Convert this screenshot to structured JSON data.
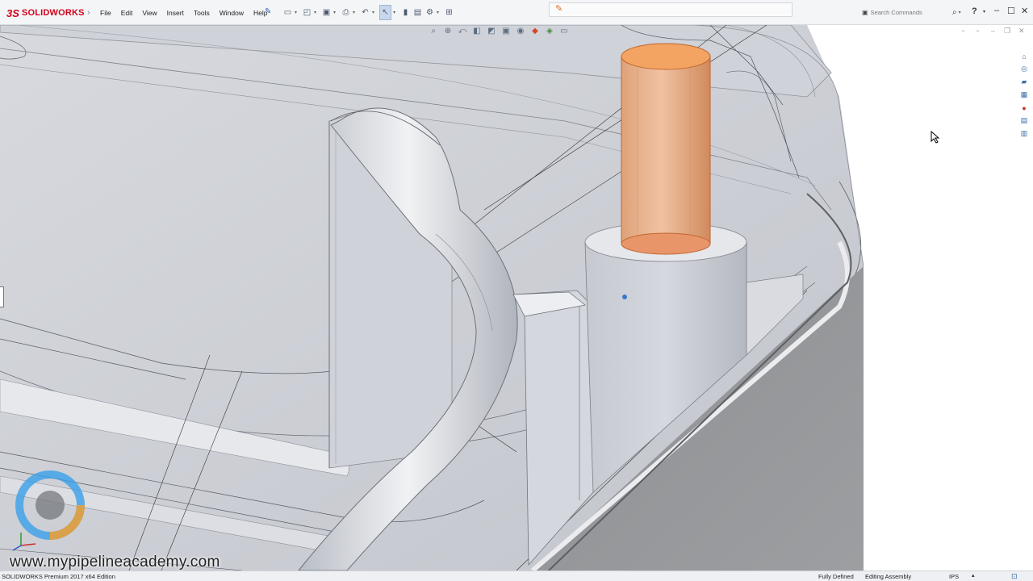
{
  "app": {
    "logo_mark": "3S",
    "logo_text": "SOLIDWORKS",
    "separator": "›"
  },
  "menu": [
    "File",
    "Edit",
    "View",
    "Insert",
    "Tools",
    "Window",
    "Help"
  ],
  "pin_icon": "pin-icon",
  "toolbar_icons": [
    "new-icon",
    "open-icon",
    "save-icon",
    "print-icon",
    "undo-icon",
    "select-icon",
    "rebuild-icon",
    "file-properties-icon",
    "options-icon",
    "sketch-icon"
  ],
  "search": {
    "placeholder": "Search Commands"
  },
  "help": {
    "label": "?"
  },
  "window_controls": {
    "minimize": "–",
    "maximize": "☐",
    "close": "✕"
  },
  "headsup_icons": [
    "zoom-to-fit-icon",
    "zoom-area-icon",
    "previous-view-icon",
    "section-view-icon",
    "view-orientation-icon",
    "display-style-icon",
    "hide-show-icon",
    "edit-appearance-icon",
    "apply-scene-icon",
    "view-settings-icon"
  ],
  "watermark": "www.mypipelineacademy.com",
  "status": {
    "product": "SOLIDWORKS Premium 2017 x64 Edition",
    "definition": "Fully Defined",
    "mode": "Editing Assembly",
    "units": "IPS",
    "units_arrow": "▴"
  },
  "colors": {
    "accent_red": "#d0021b",
    "highlight_orange": "#e8a476",
    "model_gray": "#c9ccd2",
    "academy_blue": "#3aa0e8",
    "academy_orange": "#f0a030"
  }
}
